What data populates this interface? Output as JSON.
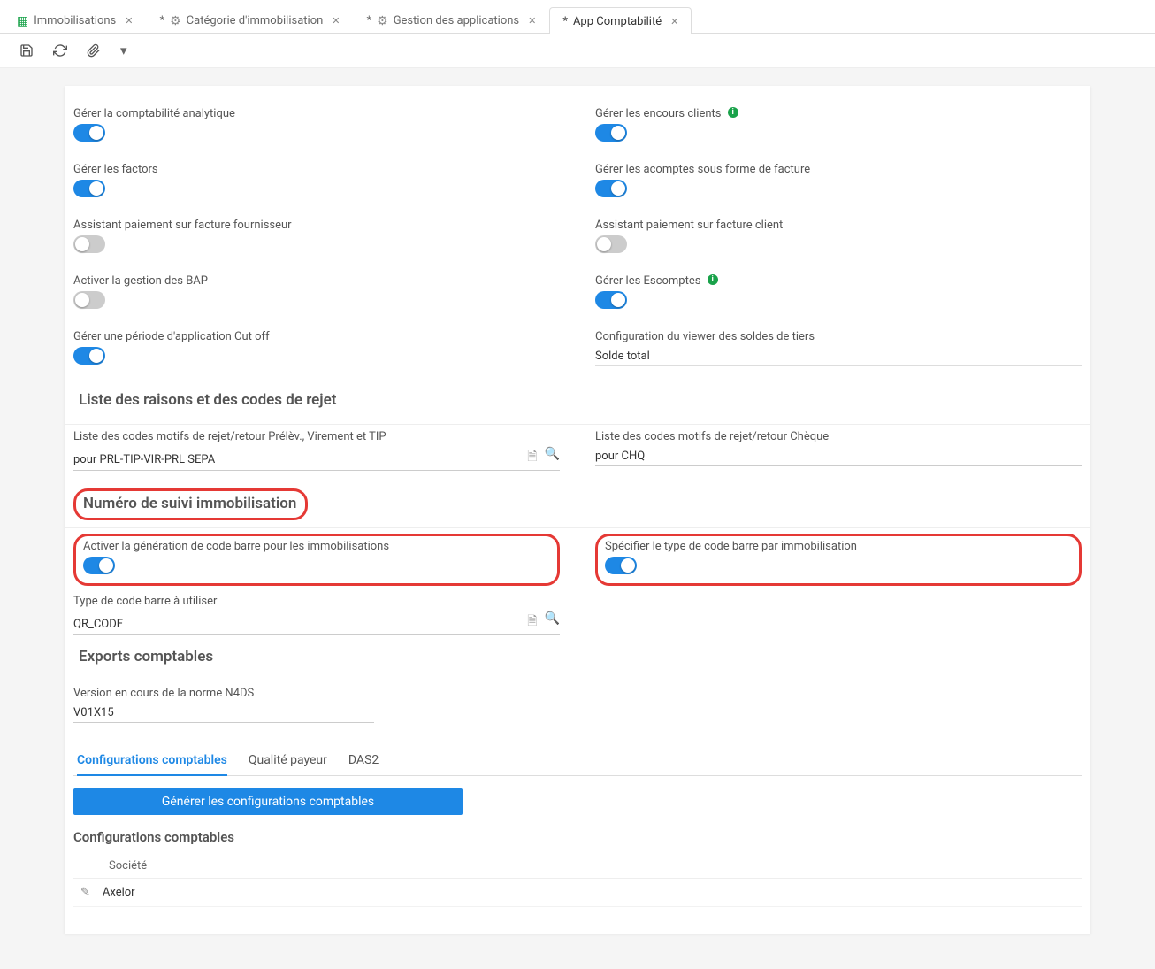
{
  "tabs": [
    {
      "label": "Immobilisations",
      "icon": "table",
      "dirty": false
    },
    {
      "label": "Catégorie d'immobilisation",
      "icon": "gear",
      "dirty": true
    },
    {
      "label": "Gestion des applications",
      "icon": "gear",
      "dirty": true
    },
    {
      "label": "App Comptabilité",
      "icon": "",
      "dirty": true,
      "active": true
    }
  ],
  "left": {
    "analytic": {
      "label": "Gérer la comptabilité analytique",
      "on": true
    },
    "factors": {
      "label": "Gérer les factors",
      "on": true
    },
    "assist_supplier": {
      "label": "Assistant paiement sur facture fournisseur",
      "on": false
    },
    "bap": {
      "label": "Activer la gestion des BAP",
      "on": false
    },
    "cutoff": {
      "label": "Gérer une période d'application Cut off",
      "on": true
    }
  },
  "right": {
    "encours": {
      "label": "Gérer les encours clients",
      "on": true,
      "info": true
    },
    "acomptes": {
      "label": "Gérer les acomptes sous forme de facture",
      "on": true
    },
    "assist_client": {
      "label": "Assistant paiement sur facture client",
      "on": false
    },
    "escomptes": {
      "label": "Gérer les Escomptes",
      "on": true,
      "info": true
    },
    "viewer": {
      "label": "Configuration du viewer des soldes de tiers",
      "value": "Solde total"
    }
  },
  "reject": {
    "section": "Liste des raisons et des codes de rejet",
    "left_label": "Liste des codes motifs de rejet/retour Prélèv., Virement et TIP",
    "left_value": "pour PRL-TIP-VIR-PRL SEPA",
    "right_label": "Liste des codes motifs de rejet/retour Chèque",
    "right_value": "pour CHQ"
  },
  "tracking": {
    "section": "Numéro de suivi immobilisation",
    "gen_label": "Activer la génération de code barre pour les immobilisations",
    "gen_on": true,
    "per_asset_label": "Spécifier le type de code barre par immobilisation",
    "per_asset_on": true,
    "type_label": "Type de code barre à utiliser",
    "type_value": "QR_CODE"
  },
  "exports": {
    "section": "Exports comptables",
    "n4ds_label": "Version en cours de la norme N4DS",
    "n4ds_value": "V01X15"
  },
  "subtabs": {
    "t1": "Configurations comptables",
    "t2": "Qualité payeur",
    "t3": "DAS2"
  },
  "generate_btn": "Générer les configurations comptables",
  "configs": {
    "title": "Configurations comptables",
    "header": "Société",
    "row0": "Axelor"
  }
}
